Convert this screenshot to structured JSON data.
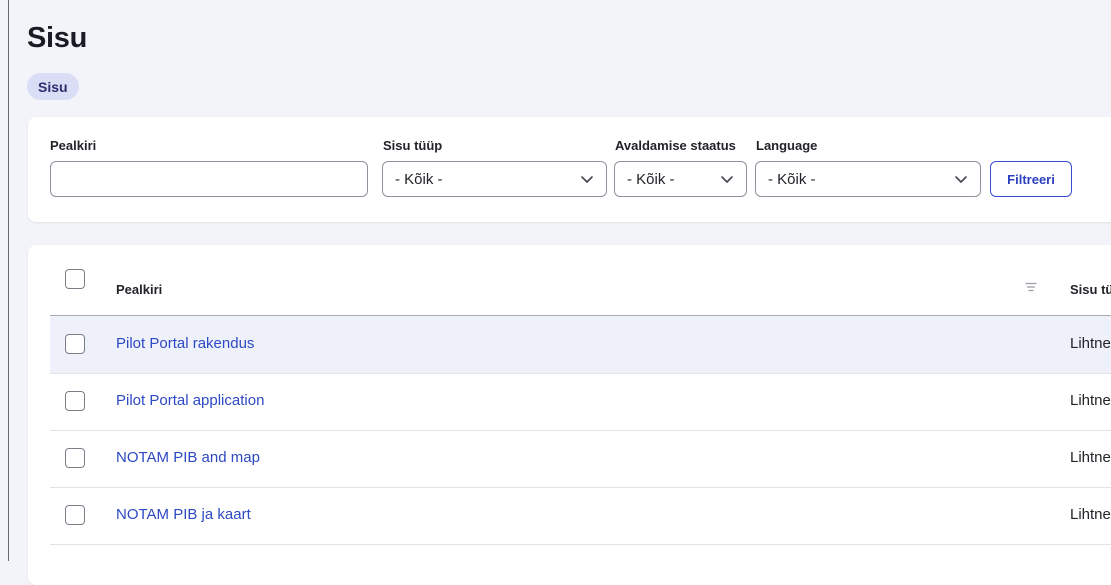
{
  "header": {
    "title": "Sisu",
    "breadcrumb": "Sisu"
  },
  "filters": {
    "title_label": "Pealkiri",
    "title_value": "",
    "type_label": "Sisu tüüp",
    "type_value": "- Kõik -",
    "status_label": "Avaldamise staatus",
    "status_value": "- Kõik -",
    "language_label": "Language",
    "language_value": "- Kõik -",
    "submit_label": "Filtreeri"
  },
  "table": {
    "columns": {
      "title": "Pealkiri",
      "type": "Sisu tüüp"
    },
    "rows": [
      {
        "title": "Pilot Portal rakendus",
        "type": "Lihtne lehekülg"
      },
      {
        "title": "Pilot Portal application",
        "type": "Lihtne lehekülg"
      },
      {
        "title": "NOTAM PIB and map",
        "type": "Lihtne lehekülg"
      },
      {
        "title": "NOTAM PIB ja kaart",
        "type": "Lihtne lehekülg"
      }
    ]
  },
  "colors": {
    "accent": "#2d49c4",
    "breadcrumb_bg": "#d9ddf6",
    "page_bg": "#f3f4f9",
    "row_highlight": "#eef0fa"
  },
  "icons": {
    "select": "chevron-down-icon",
    "sort": "sort-icon"
  }
}
